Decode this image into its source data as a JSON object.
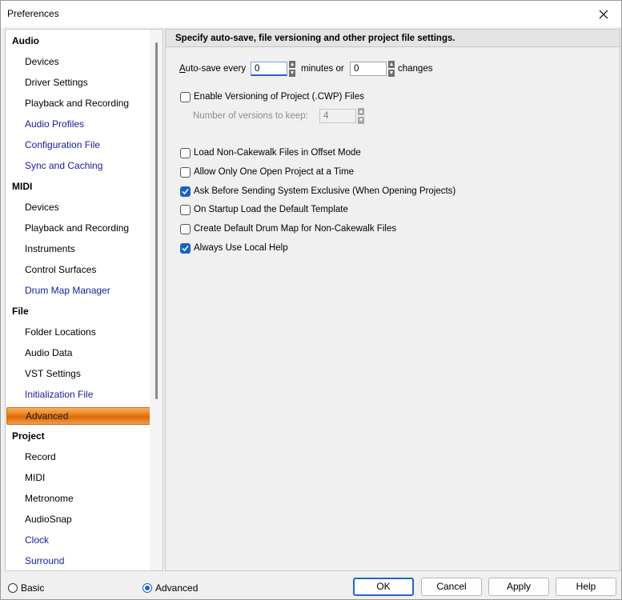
{
  "window": {
    "title": "Preferences",
    "close_icon": "close-icon"
  },
  "sidebar": {
    "groups": [
      {
        "label": "Audio",
        "items": [
          {
            "label": "Devices",
            "style": "normal"
          },
          {
            "label": "Driver Settings",
            "style": "normal"
          },
          {
            "label": "Playback and Recording",
            "style": "normal"
          },
          {
            "label": "Audio Profiles",
            "style": "link"
          },
          {
            "label": "Configuration File",
            "style": "link"
          },
          {
            "label": "Sync and Caching",
            "style": "link"
          }
        ]
      },
      {
        "label": "MIDI",
        "items": [
          {
            "label": "Devices",
            "style": "normal"
          },
          {
            "label": "Playback and Recording",
            "style": "normal"
          },
          {
            "label": "Instruments",
            "style": "normal"
          },
          {
            "label": "Control Surfaces",
            "style": "normal"
          },
          {
            "label": "Drum Map Manager",
            "style": "link"
          }
        ]
      },
      {
        "label": "File",
        "items": [
          {
            "label": "Folder Locations",
            "style": "normal"
          },
          {
            "label": "Audio Data",
            "style": "normal"
          },
          {
            "label": "VST Settings",
            "style": "normal"
          },
          {
            "label": "Initialization File",
            "style": "link"
          },
          {
            "label": "Advanced",
            "style": "selected"
          }
        ]
      },
      {
        "label": "Project",
        "items": [
          {
            "label": "Record",
            "style": "normal"
          },
          {
            "label": "MIDI",
            "style": "normal"
          },
          {
            "label": "Metronome",
            "style": "normal"
          },
          {
            "label": "AudioSnap",
            "style": "normal"
          },
          {
            "label": "Clock",
            "style": "link"
          },
          {
            "label": "Surround",
            "style": "link"
          }
        ]
      }
    ],
    "selected": "Advanced",
    "colors": {
      "link": "#1a1a9c",
      "selected_bg": "#ea7a12"
    }
  },
  "panel": {
    "header": "Specify auto-save, file versioning and other project file settings.",
    "autosave": {
      "label_prefix": "A",
      "label_rest": "uto-save every",
      "minutes_value": "0",
      "minutes_label": "minutes or",
      "changes_value": "0",
      "changes_label": "changes"
    },
    "versioning": {
      "label": "Enable Versioning of Project (.CWP) Files",
      "checked": false,
      "versions_label": "Number of versions to keep:",
      "versions_value": "4"
    },
    "options": [
      {
        "label": "Load Non-Cakewalk Files in Offset Mode",
        "checked": false
      },
      {
        "label": "Allow Only One Open Project at a Time",
        "checked": false
      },
      {
        "label": "Ask Before Sending System Exclusive (When Opening Projects)",
        "checked": true
      },
      {
        "label": "On Startup Load the Default Template",
        "checked": false
      },
      {
        "label": "Create Default Drum Map for Non-Cakewalk Files",
        "checked": false
      },
      {
        "label": "Always Use Local Help",
        "checked": true
      }
    ]
  },
  "footer": {
    "mode": "Advanced",
    "basic_label": "Basic",
    "advanced_label": "Advanced",
    "ok_label": "OK",
    "cancel_label": "Cancel",
    "apply_label": "Apply",
    "help_label": "Help"
  }
}
